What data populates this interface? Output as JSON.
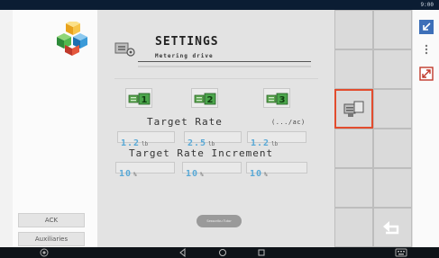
{
  "status_bar": {
    "time": "9:00"
  },
  "left_panel": {
    "logo_icon": "colored-cubes-logo-icon",
    "ack_label": "ACK",
    "auxiliaries_label": "Auxiliaries"
  },
  "header": {
    "icon": "metering-settings-icon",
    "title": "SETTINGS",
    "subtitle": "Metering drive"
  },
  "drives": [
    {
      "number": "1",
      "icon": "drive-1-icon"
    },
    {
      "number": "2",
      "icon": "drive-2-icon"
    },
    {
      "number": "3",
      "icon": "drive-3-icon"
    }
  ],
  "target_rate": {
    "label": "Target Rate",
    "unit": "(.../ac)",
    "values": [
      {
        "value": "1.2",
        "unit": "lb"
      },
      {
        "value": "2.5",
        "unit": "lb"
      },
      {
        "value": "1.2",
        "unit": "lb"
      }
    ]
  },
  "target_rate_increment": {
    "label": "Target Rate Increment",
    "values": [
      {
        "value": "10",
        "unit": "%"
      },
      {
        "value": "10",
        "unit": "%"
      },
      {
        "value": "10",
        "unit": "%"
      }
    ]
  },
  "pill_label": "Sessoribu Tutor",
  "softkeys": {
    "highlighted": "metering-drive-softkey",
    "return_icon": "return-arrow-icon"
  },
  "right_toolbar": [
    "collapse-arrow-icon",
    "more-vertical-icon",
    "swap-screen-icon"
  ],
  "nav_bar": [
    "camera-icon",
    "back-icon",
    "home-icon",
    "recents-icon",
    "keyboard-icon"
  ],
  "colors": {
    "value_text": "#5aa9d6",
    "highlight": "#e24c2e",
    "drive_green": "#4ca64c"
  }
}
